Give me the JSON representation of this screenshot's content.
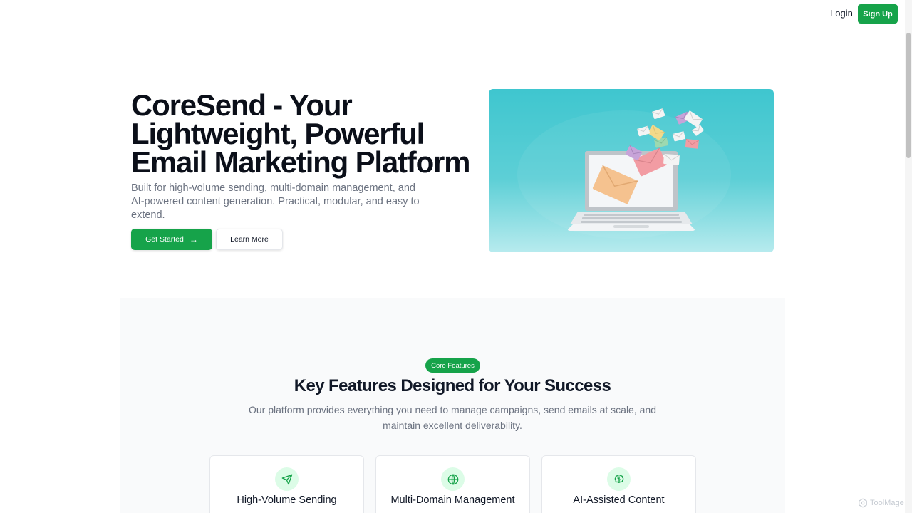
{
  "header": {
    "login_label": "Login",
    "signup_label": "Sign Up"
  },
  "hero": {
    "title_lines": [
      "CoreSend - Your",
      "Lightweight, Powerful",
      "Email Marketing Platform"
    ],
    "subtitle": "Built for high-volume sending, multi-domain management, and AI-powered content generation. Practical, modular, and easy to extend.",
    "primary_button": "Get Started",
    "secondary_button": "Learn More",
    "image_icon": "laptop-with-flying-envelopes-illustration"
  },
  "features": {
    "badge": "Core Features",
    "title": "Key Features Designed for Your Success",
    "subtitle": "Our platform provides everything you need to manage campaigns, send emails at scale, and maintain excellent deliverability.",
    "cards": [
      {
        "title": "High-Volume Sending",
        "icon": "send-icon"
      },
      {
        "title": "Multi-Domain Management",
        "icon": "globe-icon"
      },
      {
        "title": "AI-Assisted Content",
        "icon": "brain-icon"
      }
    ]
  },
  "watermark": "ToolMage",
  "colors": {
    "accent": "#16a34a",
    "accent_light": "#dcfce7",
    "hero_image_bg": "#4fcad2"
  }
}
